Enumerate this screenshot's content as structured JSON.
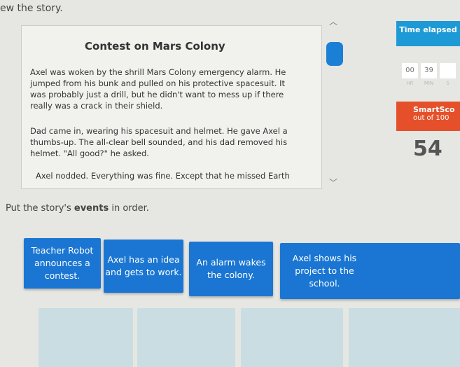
{
  "instruction_top": "ew the story.",
  "story": {
    "title": "Contest on Mars Colony",
    "paragraphs": [
      "Axel was woken by the shrill Mars Colony emergency alarm. He jumped from his bunk and pulled on his protective spacesuit. It was probably just a drill, but he didn't want to mess up if there really was a crack in their shield.",
      "Dad came in, wearing his spacesuit and helmet. He gave Axel a thumbs-up. The all-clear bell sounded, and his dad removed his helmet. \"All good?\" he asked.",
      "Axel nodded. Everything was fine. Except that he missed Earth"
    ]
  },
  "sidebar": {
    "time_label": "Time elapsed",
    "hr": "00",
    "min": "39",
    "hr_label": "HR",
    "min_label": "MIN",
    "sec_label": "S",
    "smartscore_label": "SmartSco",
    "out_of": "out of 100",
    "score": "54"
  },
  "question": {
    "prefix": "Put the story's ",
    "bold": "events",
    "suffix": " in order."
  },
  "cards": [
    "Teacher Robot announces a contest.",
    "Axel has an idea and gets to work.",
    "An alarm wakes the colony.",
    "Axel shows his project to the school."
  ],
  "colors": {
    "card": "#1a76d2",
    "time": "#1d9ad6",
    "smartscore": "#e5502a"
  }
}
